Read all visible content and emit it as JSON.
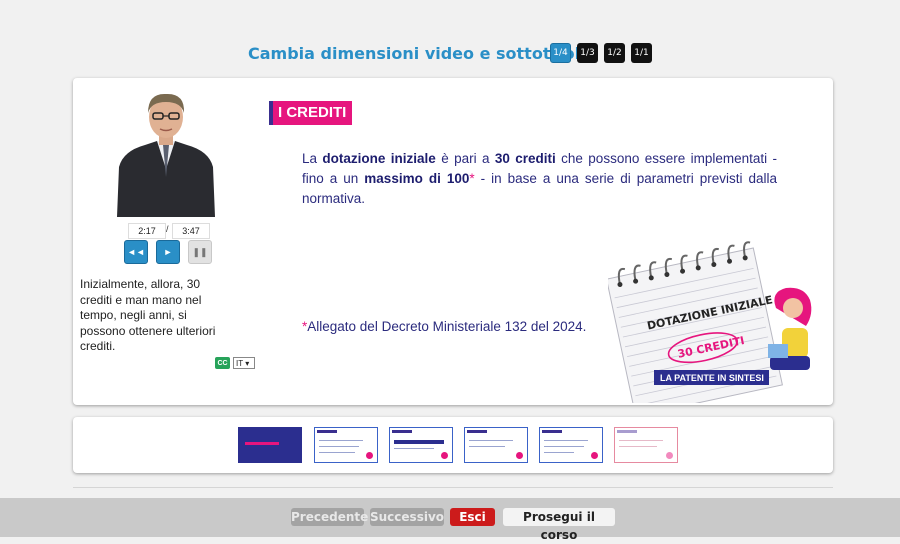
{
  "header": {
    "title": "Cambia dimensioni video e sottotitoli:",
    "sizes": [
      "1/4",
      "1/3",
      "1/2",
      "1/1"
    ],
    "active_size": "1/4"
  },
  "player": {
    "current_time": "2:17",
    "separator": "/",
    "total_time": "3:47",
    "rewind_label": "◄◄",
    "play_label": "►",
    "pause_label": "❚❚"
  },
  "subtitles": {
    "text": "Inizialmente, allora, 30 crediti e man mano nel tempo, negli anni, si possono ottenere ulteriori crediti.",
    "cc_label": "CC",
    "language": "IT"
  },
  "slide": {
    "title": "I CREDITI",
    "body": {
      "p1": "La ",
      "b1": "dotazione iniziale",
      "p2": " è pari a ",
      "b2": "30 crediti",
      "p3": " che possono essere implementati - fino a un ",
      "b3": "massimo di 100",
      "star": "*",
      "p4": " - in base a una serie di parametri previsti dalla normativa."
    },
    "footnote_star": "*",
    "footnote": "Allegato del Decreto Ministeriale 132 del 2024.",
    "notepad": {
      "heading": "DOTAZIONE INIZIALE",
      "value": "30 CREDITI",
      "banner": "LA PATENTE IN SINTESI"
    }
  },
  "footer": {
    "prev": "Precedente",
    "next": "Successivo",
    "exit": "Esci",
    "continue": "Prosegui il corso"
  },
  "colors": {
    "accent_blue": "#2a8fc7",
    "pink": "#e6157e",
    "navy": "#2b2b7e",
    "exit_red": "#cc1b1b"
  }
}
